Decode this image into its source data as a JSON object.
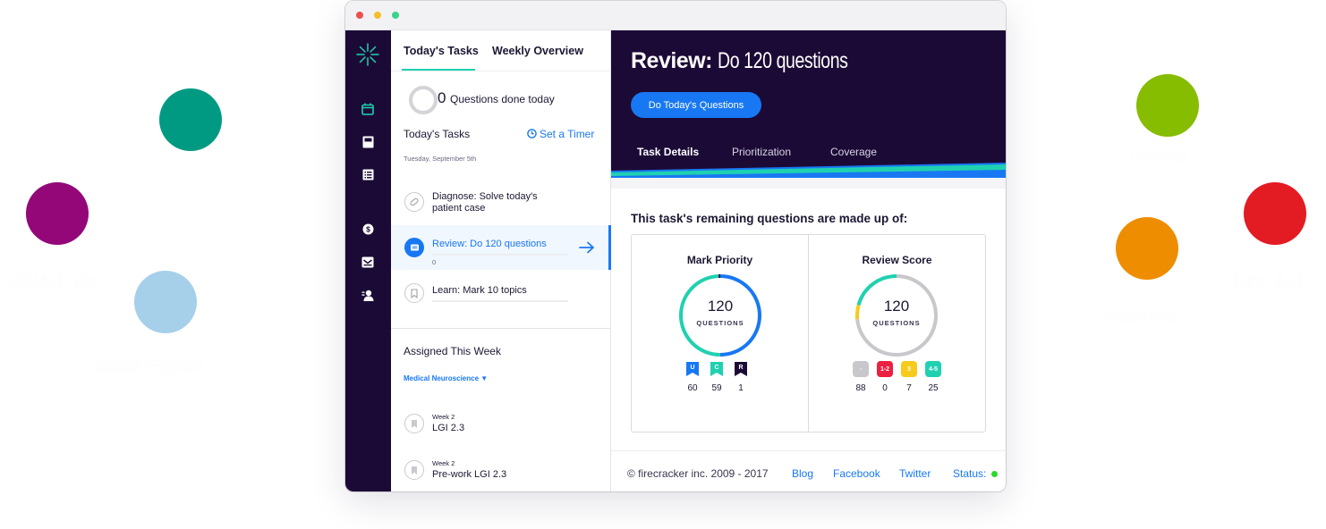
{
  "bubbles": [
    {
      "name": "bubble-teal",
      "color": "#009a83",
      "label": ""
    },
    {
      "name": "bubble-usmle",
      "color": "#930779",
      "label": "USMLE Rx"
    },
    {
      "name": "bubble-gram",
      "color": "#a6cfea",
      "label": "Gram Fighter"
    },
    {
      "name": "bubble-uworld",
      "color": "#86bd00",
      "label": "Uworld"
    },
    {
      "name": "bubble-pathoma",
      "color": "#ee8d00",
      "label": "Pathoma"
    },
    {
      "name": "bubble-firstaid",
      "color": "#e31b23",
      "label": "First Aid"
    }
  ],
  "window": {
    "dots": [
      "#ed4f4f",
      "#f4bf2c",
      "#3ad48a"
    ]
  },
  "rail": {
    "icons": [
      "firecracker-logo-icon",
      "calendar-icon",
      "book-icon",
      "list-icon",
      "dollar-icon",
      "inbox-icon",
      "user-icon"
    ]
  },
  "panel": {
    "tabs": [
      "Today's Tasks",
      "Weekly Overview"
    ],
    "done_count": "0",
    "done_label": "Questions done today",
    "section_label": "Today's Tasks",
    "timer_label": "Set a Timer",
    "date": "Tuesday, September 5th",
    "tasks": [
      {
        "title": "Diagnose: Solve today's patient case",
        "line1": "Diagnose: Solve today's",
        "line2": "patient case",
        "progress": ""
      },
      {
        "title": "Review: Do 120 questions",
        "progress": "0"
      },
      {
        "title": "Learn: Mark 10 topics",
        "progress": ""
      }
    ],
    "assigned_title": "Assigned This Week",
    "filter": "Medical Neuroscience ▼",
    "assigned": [
      {
        "week": "Week 2",
        "title": "LGI 2.3"
      },
      {
        "week": "Week 2",
        "title": "Pre-work LGI 2.3"
      }
    ]
  },
  "main": {
    "title_strong": "Review:",
    "title_light": "Do 120 questions",
    "cta": "Do Today's Questions",
    "tabs": [
      "Task Details",
      "Prioritization",
      "Coverage"
    ],
    "section_title": "This task's remaining questions are made up of:",
    "mark_priority": {
      "title": "Mark Priority",
      "total": "120",
      "unit": "QUESTIONS",
      "badges": [
        {
          "label": "U",
          "count": "60",
          "color": "#1878f3"
        },
        {
          "label": "C",
          "count": "59",
          "color": "#1fd1b0"
        },
        {
          "label": "R",
          "count": "1",
          "color": "#1c0a36"
        }
      ]
    },
    "review_score": {
      "title": "Review Score",
      "total": "120",
      "unit": "QUESTIONS",
      "badges": [
        {
          "label": "-",
          "count": "88",
          "color": "#c8c8cc"
        },
        {
          "label": "1-2",
          "count": "0",
          "color": "#ec2040"
        },
        {
          "label": "3",
          "count": "7",
          "color": "#f6cb1c"
        },
        {
          "label": "4-5",
          "count": "25",
          "color": "#1fd1b0"
        }
      ]
    },
    "footer": {
      "copyright": "© firecracker inc. 2009 - 2017",
      "links": [
        "Blog",
        "Facebook",
        "Twitter"
      ],
      "status_label": "Status:",
      "status_color": "#2bd92b"
    }
  },
  "colors": {
    "rail_bg": "#1c0a36",
    "accent_teal": "#1fd1b0",
    "accent_blue": "#1878f3"
  }
}
